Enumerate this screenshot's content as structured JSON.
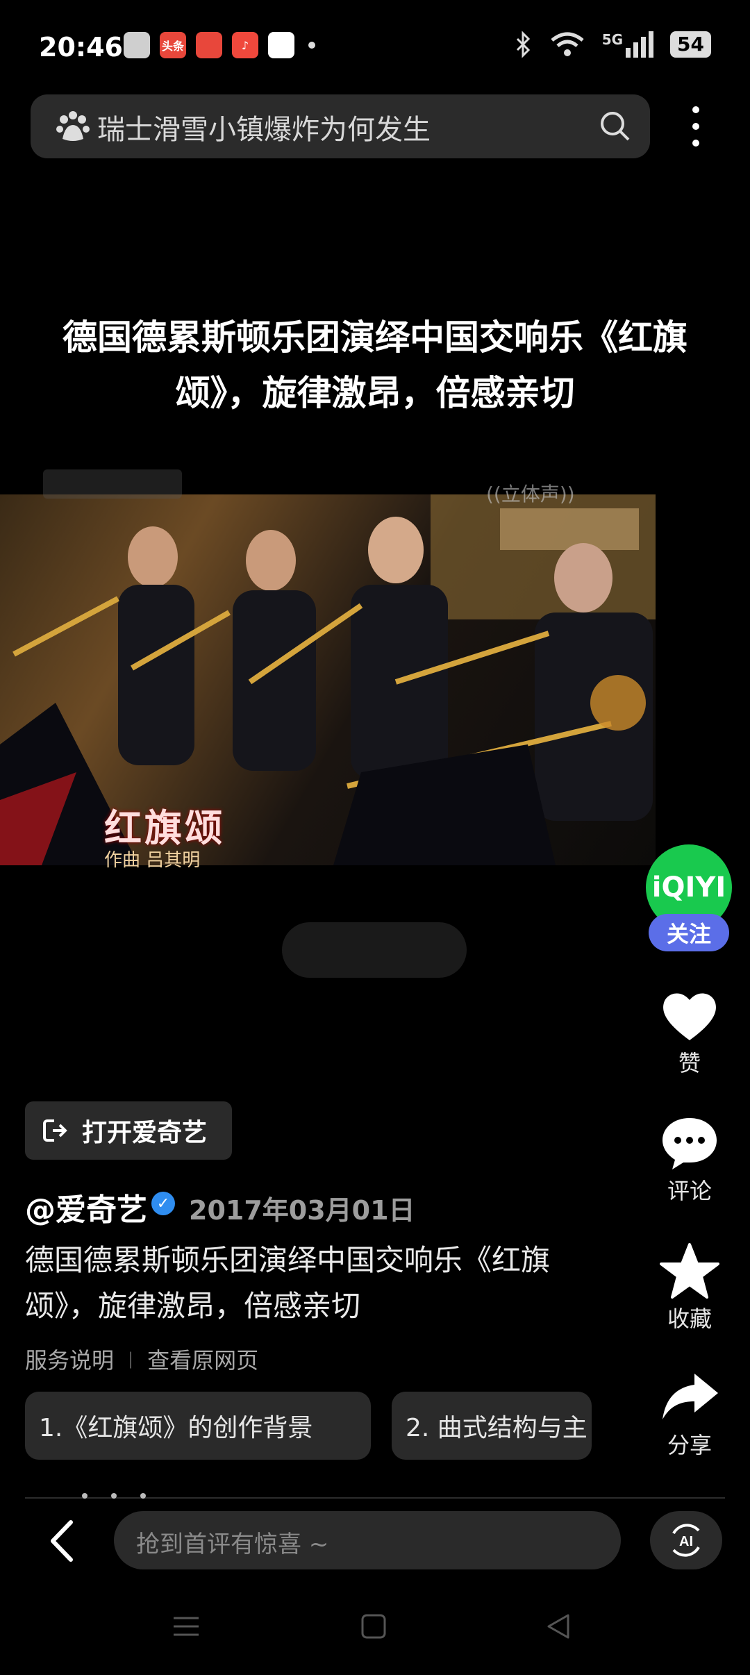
{
  "status_bar": {
    "time": "20:46",
    "app_icons": [
      {
        "icon": "wechat-icon",
        "color": "#cfcfcf",
        "text": ""
      },
      {
        "icon": "toutiao-icon",
        "color": "#e8473b",
        "text": "头条"
      },
      {
        "icon": "video-app-icon",
        "color": "#e8473b",
        "text": ""
      },
      {
        "icon": "music-app-icon",
        "color": "#f0483c",
        "text": "♪"
      },
      {
        "icon": "app-icon",
        "color": "#ffffff",
        "text": ""
      }
    ],
    "network": "5G",
    "battery": "54"
  },
  "search": {
    "query": "瑞士滑雪小镇爆炸为何发生"
  },
  "post": {
    "title": "德国德累斯顿乐团演绎中国交响乐《红旗颂》，旋律激昂，倍感亲切",
    "video": {
      "watermark_right": "((立体声))",
      "overlay_title": "红旗颂",
      "overlay_subtitle": "作曲 吕其明"
    },
    "open_app_label": "打开爱奇艺",
    "author": "@爱奇艺",
    "date": "2017年03月01日",
    "description": "德国德累斯顿乐团演绎中国交响乐《红旗颂》，旋律激昂，倍感亲切",
    "links": [
      "服务说明",
      "查看原网页"
    ],
    "chips": [
      "1.《红旗颂》的创作背景",
      "2. 曲式结构与主"
    ]
  },
  "rail": {
    "brand": "iQIYI",
    "follow": "关注",
    "like": "赞",
    "comment": "评论",
    "favorite": "收藏",
    "share": "分享"
  },
  "bottom": {
    "comment_placeholder": "抢到首评有惊喜 ~",
    "ai_label": "AI"
  },
  "colors": {
    "background": "#000000",
    "iqiyi_green": "#19c94e",
    "follow_blue": "#5b6ee8",
    "verified_blue": "#2f8df0"
  }
}
